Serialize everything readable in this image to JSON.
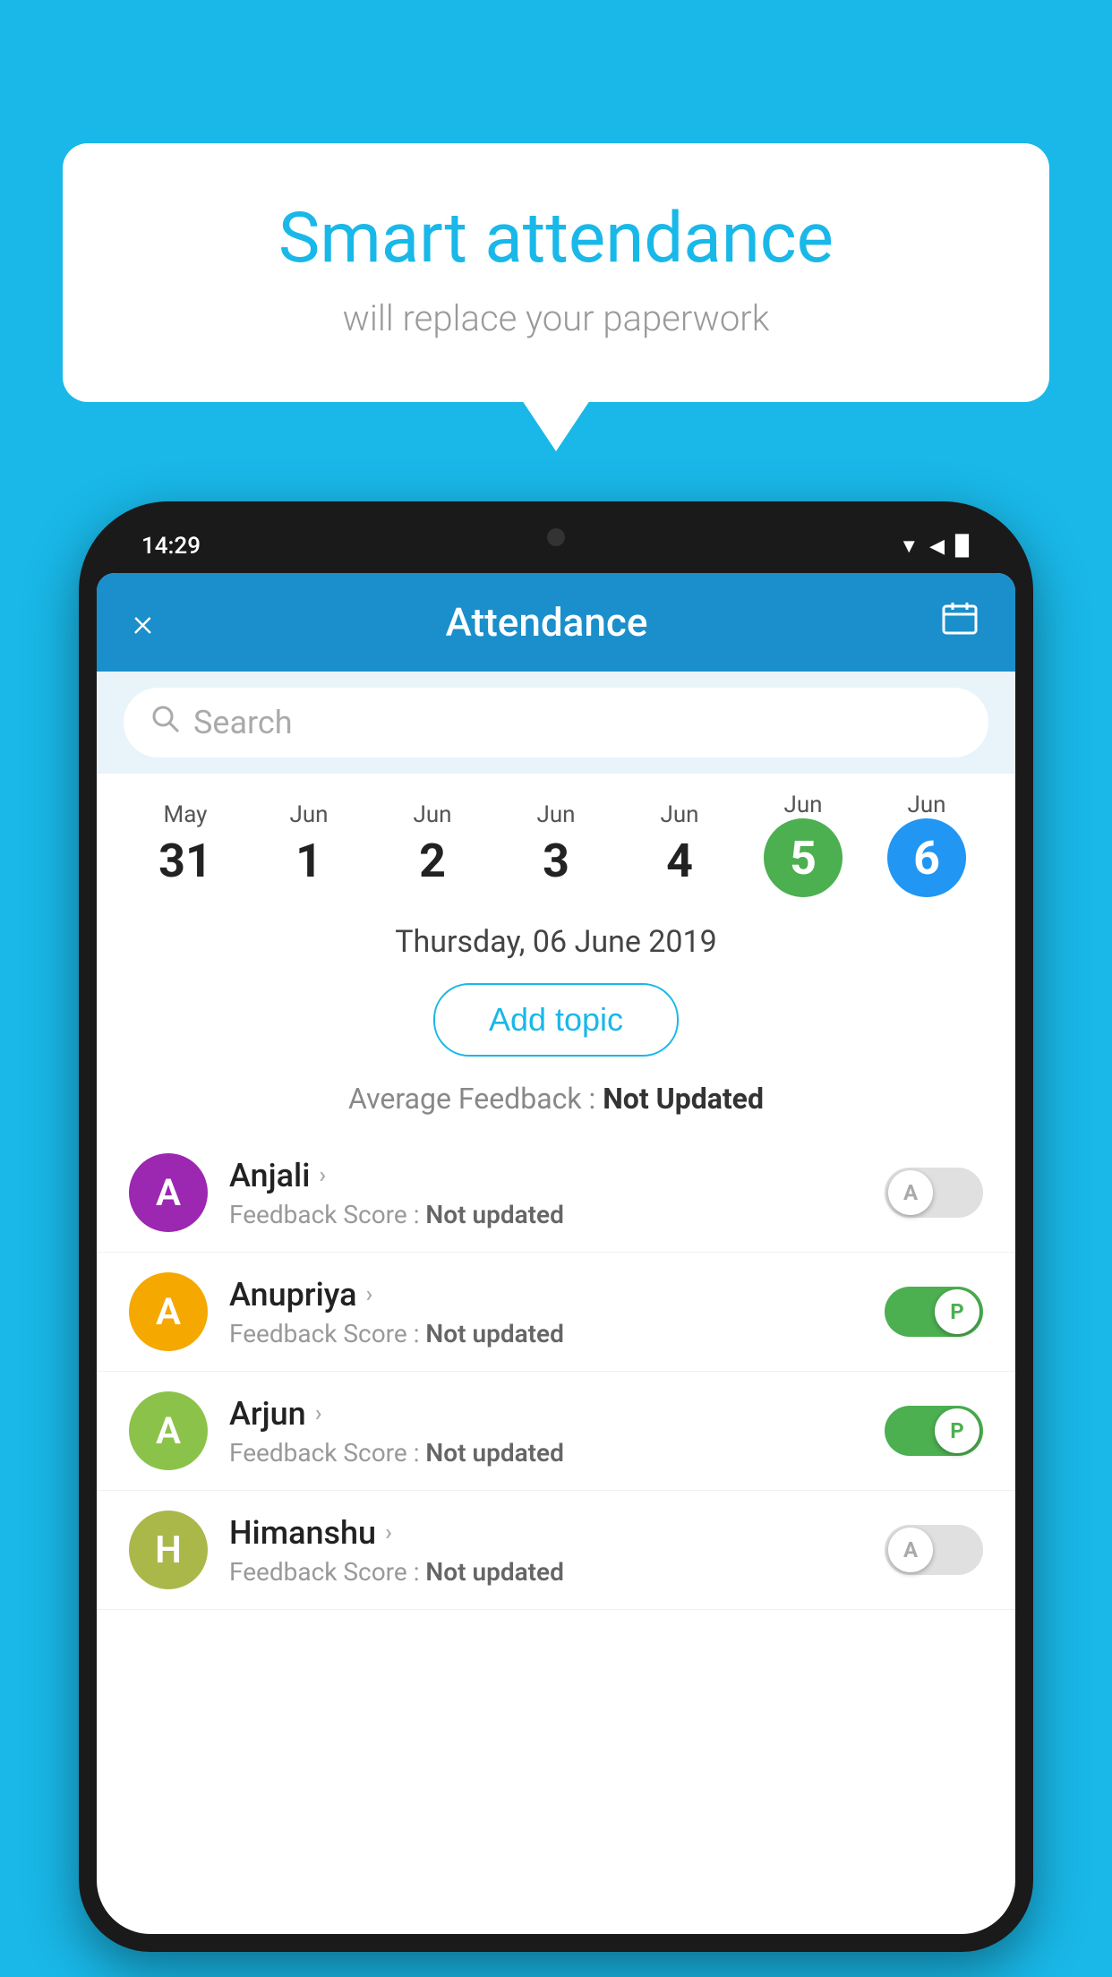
{
  "background_color": "#19b8e8",
  "bubble": {
    "title": "Smart attendance",
    "subtitle": "will replace your paperwork"
  },
  "phone": {
    "status_time": "14:29",
    "header": {
      "title": "Attendance",
      "close_label": "×",
      "calendar_label": "📅"
    },
    "search": {
      "placeholder": "Search"
    },
    "dates": [
      {
        "month": "May",
        "day": "31",
        "selected": ""
      },
      {
        "month": "Jun",
        "day": "1",
        "selected": ""
      },
      {
        "month": "Jun",
        "day": "2",
        "selected": ""
      },
      {
        "month": "Jun",
        "day": "3",
        "selected": ""
      },
      {
        "month": "Jun",
        "day": "4",
        "selected": ""
      },
      {
        "month": "Jun",
        "day": "5",
        "selected": "green"
      },
      {
        "month": "Jun",
        "day": "6",
        "selected": "blue"
      }
    ],
    "selected_date_label": "Thursday, 06 June 2019",
    "add_topic_label": "Add topic",
    "average_feedback": {
      "label": "Average Feedback : ",
      "value": "Not Updated"
    },
    "students": [
      {
        "name": "Anjali",
        "avatar_letter": "A",
        "avatar_color": "#9c27b0",
        "feedback_label": "Feedback Score : ",
        "feedback_value": "Not updated",
        "toggle": "off",
        "toggle_letter": "A"
      },
      {
        "name": "Anupriya",
        "avatar_letter": "A",
        "avatar_color": "#f4a800",
        "feedback_label": "Feedback Score : ",
        "feedback_value": "Not updated",
        "toggle": "on",
        "toggle_letter": "P"
      },
      {
        "name": "Arjun",
        "avatar_letter": "A",
        "avatar_color": "#8bc34a",
        "feedback_label": "Feedback Score : ",
        "feedback_value": "Not updated",
        "toggle": "on",
        "toggle_letter": "P"
      },
      {
        "name": "Himanshu",
        "avatar_letter": "H",
        "avatar_color": "#aab84a",
        "feedback_label": "Feedback Score : ",
        "feedback_value": "Not updated",
        "toggle": "off",
        "toggle_letter": "A"
      }
    ]
  }
}
